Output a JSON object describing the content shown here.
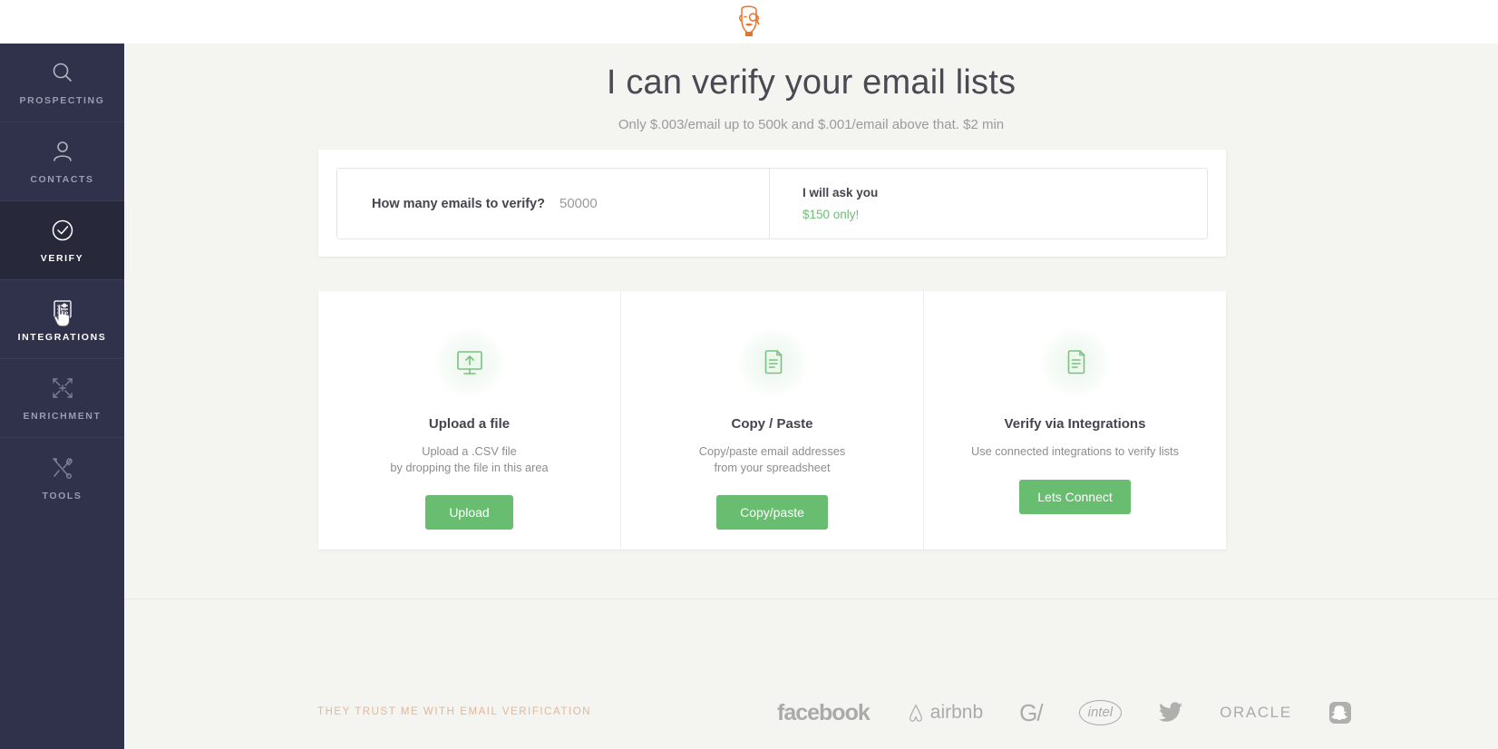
{
  "header": {
    "logo_icon": "monocle-face-logo"
  },
  "sidebar": {
    "items": [
      {
        "label": "PROSPECTING",
        "icon": "search-icon",
        "state": "default"
      },
      {
        "label": "CONTACTS",
        "icon": "user-icon",
        "state": "default"
      },
      {
        "label": "VERIFY",
        "icon": "check-circle-icon",
        "state": "active"
      },
      {
        "label": "INTEGRATIONS",
        "icon": "sliders-panel-icon",
        "state": "hovered"
      },
      {
        "label": "ENRICHMENT",
        "icon": "converge-arrows-icon",
        "state": "default"
      },
      {
        "label": "TOOLS",
        "icon": "tools-cross-icon",
        "state": "default"
      }
    ],
    "cursor": "pointing-hand-cursor"
  },
  "hero": {
    "title": "I can verify your email lists",
    "subtitle": "Only $.003/email up to 500k and $.001/email above that. $2 min"
  },
  "calculator": {
    "question_label": "How many emails to verify?",
    "amount_value": "50000",
    "amount_placeholder": "50000",
    "ask_label": "I will ask you",
    "price_text": "$150 only!",
    "price_color": "#6cbf73"
  },
  "options": [
    {
      "icon": "monitor-upload-icon",
      "title": "Upload a file",
      "desc_line1": "Upload a .CSV file",
      "desc_line2": "by dropping the file in this area",
      "button": "Upload"
    },
    {
      "icon": "documents-copy-icon",
      "title": "Copy / Paste",
      "desc_line1": "Copy/paste email addresses",
      "desc_line2": "from your spreadsheet",
      "button": "Copy/paste"
    },
    {
      "icon": "documents-copy-icon",
      "title": "Verify via Integrations",
      "desc_line1": "Use connected integrations to verify lists",
      "desc_line2": "",
      "button": "Lets Connect"
    }
  ],
  "footer": {
    "trust_text": "THEY TRUST ME WITH EMAIL VERIFICATION",
    "trust_color": "#e0b89a",
    "brands": [
      {
        "name": "facebook",
        "label": "facebook"
      },
      {
        "name": "airbnb",
        "label": "airbnb"
      },
      {
        "name": "google",
        "label": "G/"
      },
      {
        "name": "intel",
        "label": "intel"
      },
      {
        "name": "twitter",
        "label": ""
      },
      {
        "name": "oracle",
        "label": "ORACLE"
      },
      {
        "name": "snapchat",
        "label": ""
      }
    ]
  },
  "theme": {
    "accent_green": "#68bd70",
    "sidebar_bg": "#30314a",
    "sidebar_active_bg": "#272839",
    "page_bg": "#f4f4f1"
  }
}
